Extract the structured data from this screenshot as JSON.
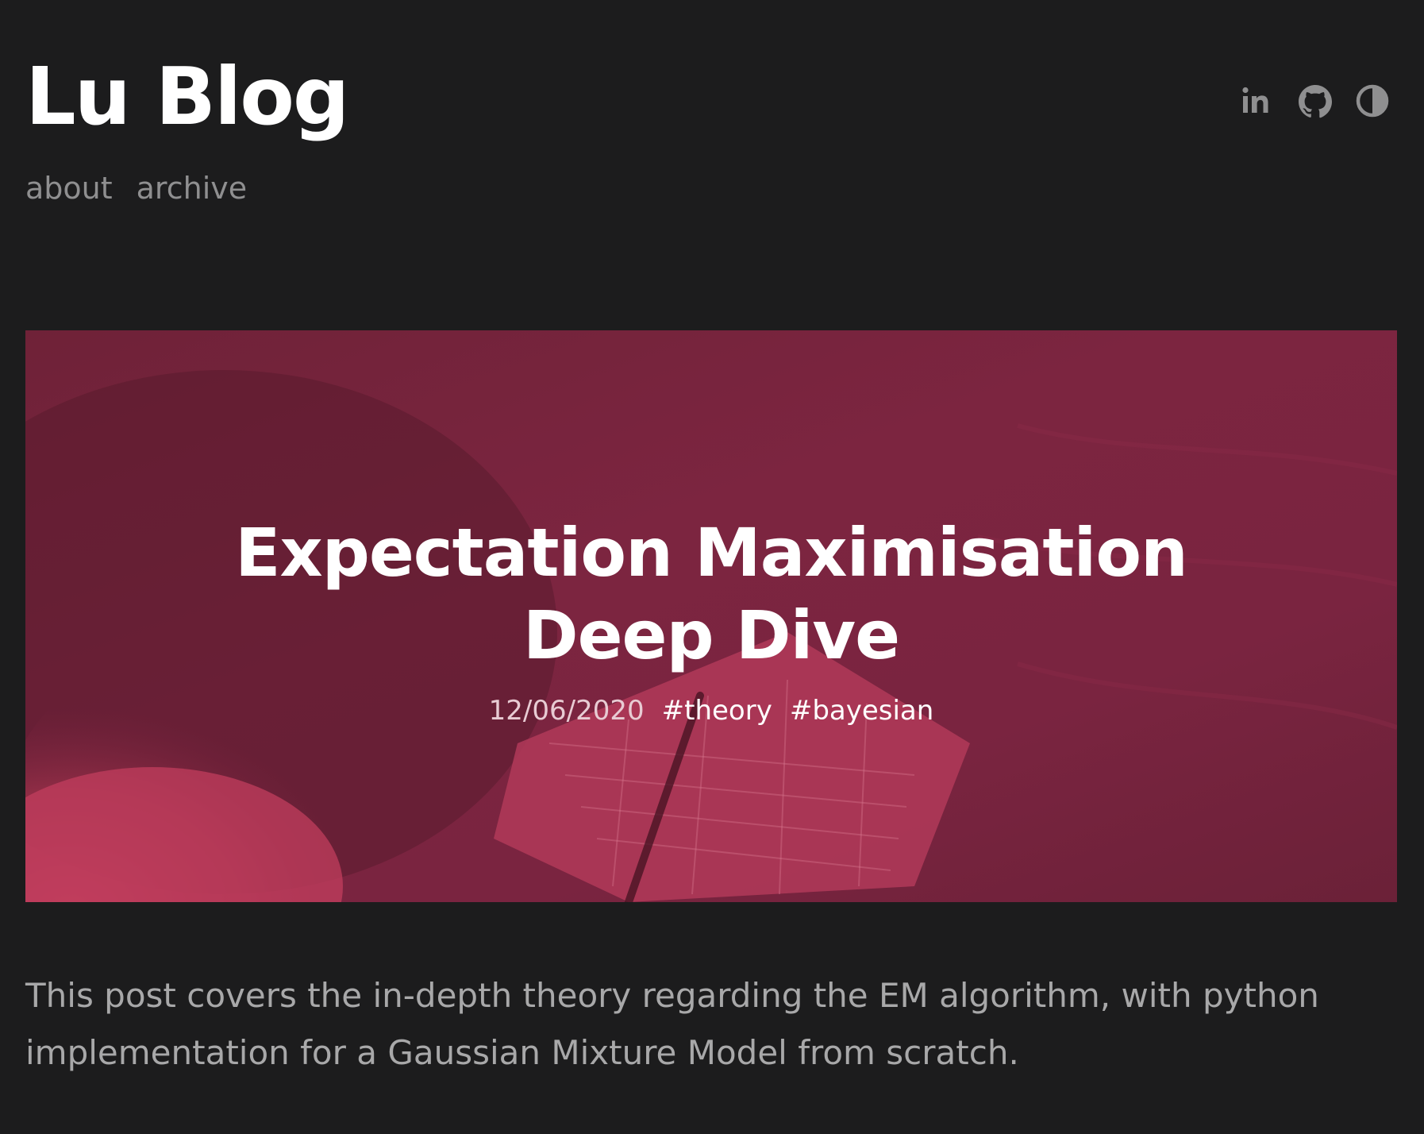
{
  "header": {
    "title": "Lu Blog",
    "nav": [
      {
        "label": "about"
      },
      {
        "label": "archive"
      }
    ],
    "icons": [
      "linkedin-icon",
      "github-icon",
      "theme-toggle-icon"
    ]
  },
  "hero": {
    "title": "Expectation Maximisation Deep Dive",
    "date": "12/06/2020",
    "tags": [
      "#theory",
      "#bayesian"
    ],
    "overlay_color": "#7c2540"
  },
  "excerpt": "This post covers the in-depth theory regarding the EM algorithm, with python implementation for a Gaussian Mixture Model from scratch."
}
